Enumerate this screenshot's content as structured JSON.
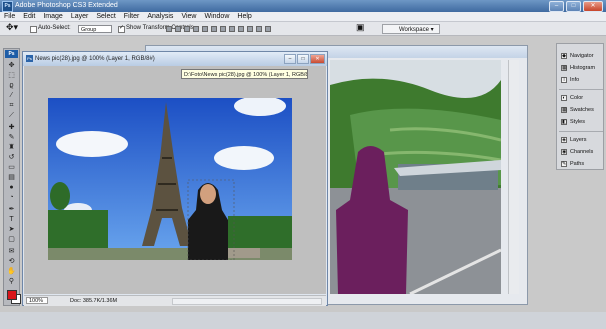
{
  "app": {
    "title": "Adobe Photoshop CS3 Extended",
    "logo_text": "Ps"
  },
  "window_controls": {
    "minimize": "–",
    "maximize": "□",
    "close": "✕"
  },
  "menu": [
    "File",
    "Edit",
    "Image",
    "Layer",
    "Select",
    "Filter",
    "Analysis",
    "View",
    "Window",
    "Help"
  ],
  "options_bar": {
    "auto_select_label": "Auto-Select:",
    "auto_select_checked": false,
    "group_value": "Group",
    "show_transform_label": "Show Transform Controls",
    "show_transform_checked": true,
    "workspace_label": "Workspace ▾"
  },
  "toolbox": {
    "badge": "Ps",
    "tools": [
      "move-tool",
      "marquee-tool",
      "lasso-tool",
      "quick-select-tool",
      "crop-tool",
      "eyedropper-tool",
      "healing-tool",
      "brush-tool",
      "clone-stamp-tool",
      "history-brush-tool",
      "eraser-tool",
      "gradient-tool",
      "blur-tool",
      "dodge-tool",
      "pen-tool",
      "type-tool",
      "path-select-tool",
      "shape-tool",
      "notes-tool",
      "3d-rotate-tool",
      "hand-tool",
      "zoom-tool"
    ],
    "foreground_color": "#d9151a",
    "background_color": "#ffffff"
  },
  "document": {
    "title": "News pic(28).jpg @ 100% (Layer 1, RGB/8#)",
    "tooltip": "D:\\Foto\\News pic(28).jpg @ 100% (Layer 1, RGB/8#)",
    "zoom": "100%",
    "doc_info": "Doc: 385.7K/1.36M"
  },
  "panels": [
    {
      "name": "navigator",
      "label": "Navigator",
      "icon": "◆"
    },
    {
      "name": "histogram",
      "label": "Histogram",
      "icon": "▦"
    },
    {
      "name": "info",
      "label": "Info",
      "icon": "i"
    },
    {
      "name": "color",
      "label": "Color",
      "icon": "◐"
    },
    {
      "name": "swatches",
      "label": "Swatches",
      "icon": "▦"
    },
    {
      "name": "styles",
      "label": "Styles",
      "icon": "◧"
    },
    {
      "name": "layers",
      "label": "Layers",
      "icon": "◈"
    },
    {
      "name": "channels",
      "label": "Channels",
      "icon": "◉"
    },
    {
      "name": "paths",
      "label": "Paths",
      "icon": "✎"
    }
  ]
}
